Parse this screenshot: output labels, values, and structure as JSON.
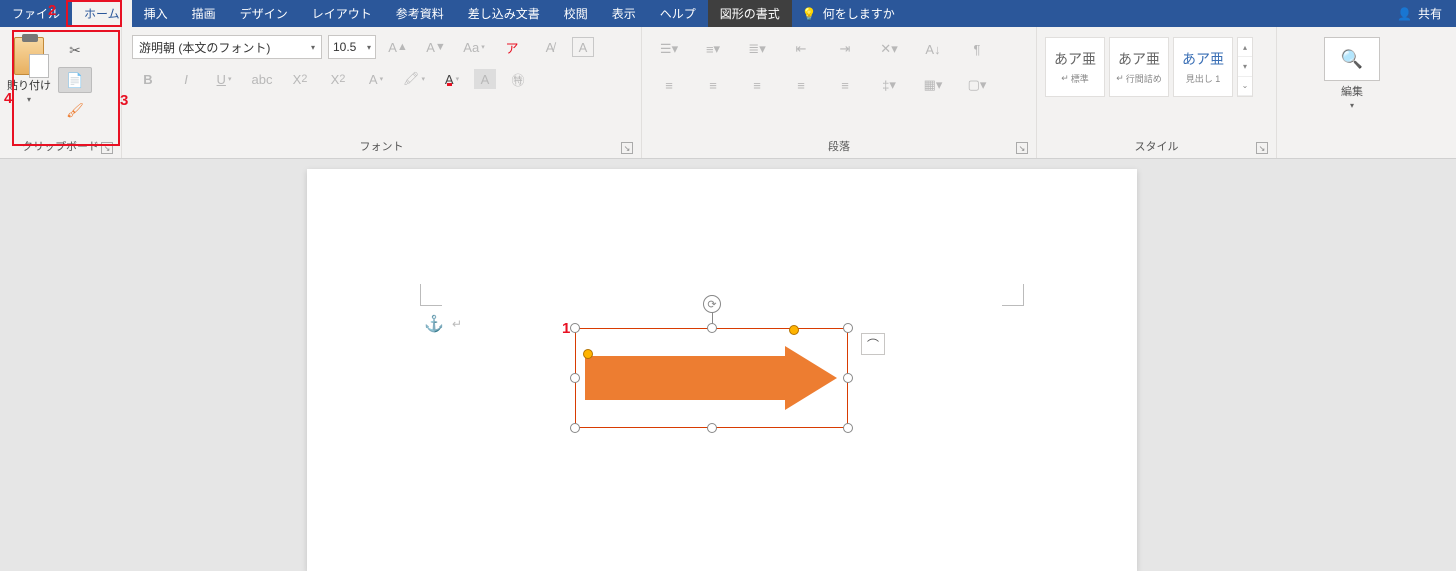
{
  "tabs": {
    "file": "ファイル",
    "home": "ホーム",
    "insert": "挿入",
    "draw": "描画",
    "design": "デザイン",
    "layout": "レイアウト",
    "references": "参考資料",
    "mailings": "差し込み文書",
    "review": "校閲",
    "view": "表示",
    "help": "ヘルプ",
    "shape_format": "図形の書式"
  },
  "tellme": {
    "placeholder": "何をしますか"
  },
  "share": {
    "label": "共有"
  },
  "clipboard": {
    "paste": "貼り付け",
    "group_label": "クリップボード"
  },
  "font": {
    "name": "游明朝 (本文のフォント)",
    "size": "10.5",
    "group_label": "フォント"
  },
  "paragraph": {
    "group_label": "段落"
  },
  "styles": {
    "group_label": "スタイル",
    "sample": "あア亜",
    "normal": "標準",
    "no_spacing": "行間詰め",
    "heading1": "見出し 1"
  },
  "editing": {
    "group_label": "編集"
  },
  "annotations": {
    "n1": "1",
    "n2": "2",
    "n3": "3",
    "n4": "4"
  }
}
